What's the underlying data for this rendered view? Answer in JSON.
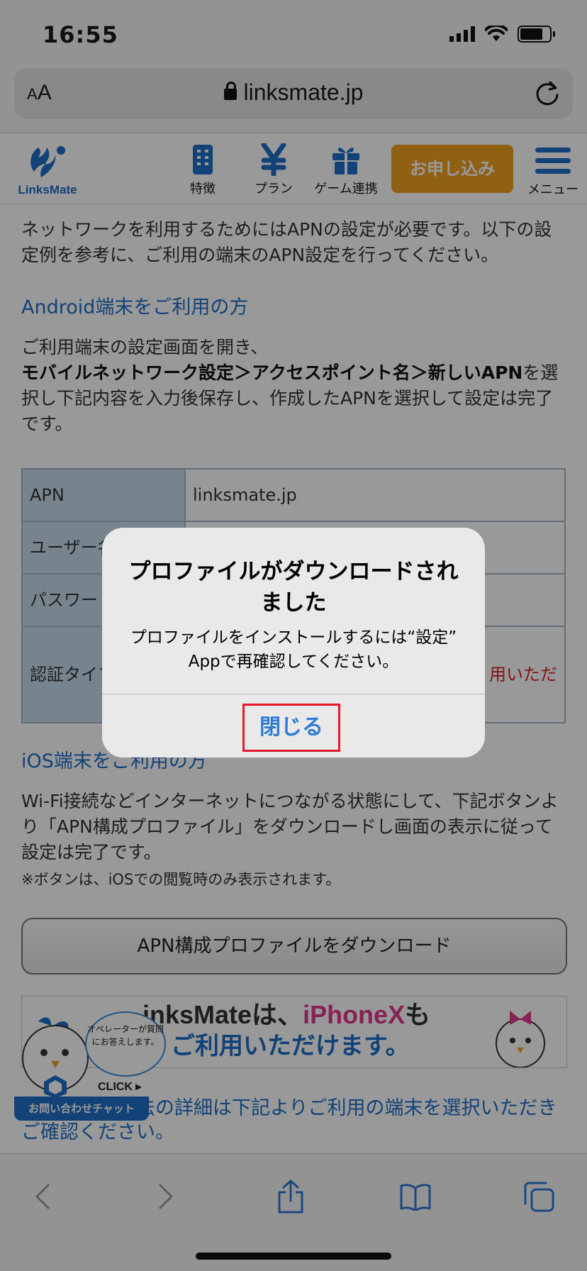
{
  "status_bar": {
    "time": "16:55"
  },
  "browser": {
    "font_button_small": "A",
    "font_button_large": "A",
    "url": "linksmate.jp"
  },
  "site_header": {
    "logo_text": "LinksMate",
    "nav": [
      {
        "label": "特徴",
        "icon": "building-icon"
      },
      {
        "label": "プラン",
        "icon": "yen-icon"
      },
      {
        "label": "ゲーム連携",
        "icon": "gift-icon"
      }
    ],
    "apply_label": "お申し込み",
    "menu_label": "メニュー"
  },
  "content": {
    "intro": "ネットワークを利用するためにはAPNの設定が必要です。以下の設定例を参考に、ご利用の端末のAPN設定を行ってください。",
    "android_title": "Android端末をご利用の方",
    "android_para_1": "ご利用端末の設定画面を開き、",
    "android_para_bold": "モバイルネットワーク設定＞アクセスポイント名＞新しいAPN",
    "android_para_2": "を選択し下記内容を入力後保存し、作成したAPNを選択して設定は完了です。",
    "table": [
      {
        "key": "APN",
        "value": "linksmate.jp"
      },
      {
        "key": "ユーザー名",
        "value": ""
      },
      {
        "key": "パスワード",
        "value": ""
      },
      {
        "key": "認証タイプ",
        "value": "用いただ"
      }
    ],
    "ios_title": "iOS端末をご利用の方",
    "ios_para": "Wi-Fi接続などインターネットにつながる状態にして、下記ボタンより「APN構成プロファイル」をダウンロードし画面の表示に従って設定は完了です。",
    "ios_note": "※ボタンは、iOSでの閲覧時のみ表示されます。",
    "download_button": "APN構成プロファイルをダウンロード",
    "banner_line1_a": "inksMateは、",
    "banner_line1_b": "iPhoneX",
    "banner_line1_c": "も",
    "banner_line2": "ご利用いただけます。",
    "bottom_link": "端末別設定方法の詳細は下記よりご利用の端末を選択いただきご確認ください。"
  },
  "chat_widget": {
    "bubble": "オペレーターが質問にお答えします。",
    "click": "CLICK ▸",
    "label": "お問い合わせチャット"
  },
  "dialog": {
    "title": "プロファイルがダウンロードされました",
    "message": "プロファイルをインストールするには“設定” Appで再確認してください。",
    "close_button": "閉じる"
  },
  "colors": {
    "brand_blue": "#1f6fc7",
    "apply_orange": "#f0a120",
    "highlight_red": "#e8192c"
  }
}
